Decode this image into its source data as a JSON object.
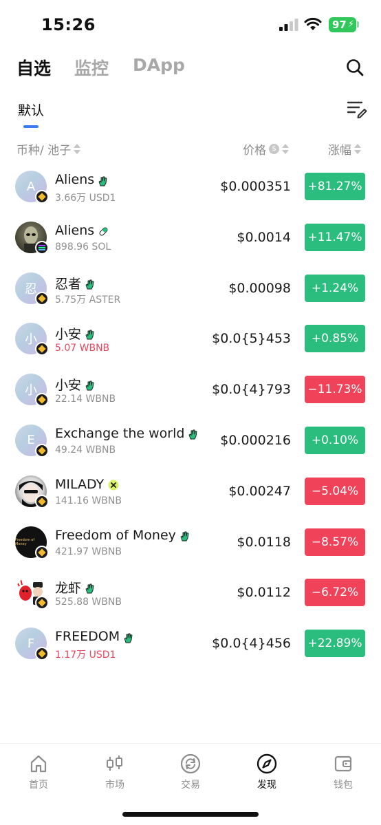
{
  "status_bar": {
    "time": "15:26",
    "battery": "97"
  },
  "top_tabs": [
    {
      "label": "自选",
      "active": true
    },
    {
      "label": "监控",
      "active": false
    },
    {
      "label": "DApp",
      "active": false
    }
  ],
  "sub_tabs": [
    {
      "label": "默认",
      "active": true
    }
  ],
  "columns": {
    "name": "币种/ 池子",
    "price": "价格",
    "change": "涨幅"
  },
  "rows": [
    {
      "name": "Aliens",
      "avatar": "A",
      "sub": "3.66万 USD1",
      "sub_red": false,
      "price": "$0.000351",
      "change": "+81.27%",
      "direction": "up",
      "chain": "bnb",
      "tag": "hand"
    },
    {
      "name": "Aliens",
      "avatar": "",
      "sub": "898.96 SOL",
      "sub_red": false,
      "price": "$0.0014",
      "change": "+11.47%",
      "direction": "up",
      "chain": "sol",
      "tag": "pill"
    },
    {
      "name": "忍者",
      "avatar": "忍",
      "sub": "5.75万 ASTER",
      "sub_red": false,
      "price": "$0.00098",
      "change": "+1.24%",
      "direction": "up",
      "chain": "bnb",
      "tag": "hand"
    },
    {
      "name": "小安",
      "avatar": "小",
      "sub": "5.07 WBNB",
      "sub_red": true,
      "price": "$0.0{5}453",
      "change": "+0.85%",
      "direction": "up",
      "chain": "bnb",
      "tag": "hand"
    },
    {
      "name": "小安",
      "avatar": "小",
      "sub": "22.14 WBNB",
      "sub_red": false,
      "price": "$0.0{4}793",
      "change": "−11.73%",
      "direction": "down",
      "chain": "bnb",
      "tag": "hand"
    },
    {
      "name": "Exchange the world",
      "avatar": "E",
      "sub": "49.24 WBNB",
      "sub_red": false,
      "price": "$0.000216",
      "change": "+0.10%",
      "direction": "up",
      "chain": "bnb",
      "tag": "hand"
    },
    {
      "name": "MILADY",
      "avatar": "",
      "sub": "141.16 WBNB",
      "sub_red": false,
      "price": "$0.00247",
      "change": "−5.04%",
      "direction": "down",
      "chain": "bnb",
      "tag": "x"
    },
    {
      "name": "Freedom of Money",
      "avatar": "Freedom of Money",
      "sub": "421.97 WBNB",
      "sub_red": false,
      "price": "$0.0118",
      "change": "−8.57%",
      "direction": "down",
      "chain": "bnb",
      "tag": "hand"
    },
    {
      "name": "龙虾",
      "avatar": "",
      "sub": "525.88 WBNB",
      "sub_red": false,
      "price": "$0.0112",
      "change": "−6.72%",
      "direction": "down",
      "chain": "bnb",
      "tag": "hand"
    },
    {
      "name": "FREEDOM",
      "avatar": "F",
      "sub": "1.17万 USD1",
      "sub_red": true,
      "price": "$0.0{4}456",
      "change": "+22.89%",
      "direction": "up",
      "chain": "bnb",
      "tag": "hand"
    }
  ],
  "bottom_nav": [
    {
      "label": "首页",
      "icon": "home-icon",
      "active": false
    },
    {
      "label": "市场",
      "icon": "candlestick-icon",
      "active": false
    },
    {
      "label": "交易",
      "icon": "swap-icon",
      "active": false
    },
    {
      "label": "发现",
      "icon": "compass-icon",
      "active": true
    },
    {
      "label": "钱包",
      "icon": "wallet-icon",
      "active": false
    }
  ],
  "colors": {
    "up": "#2bbd7e",
    "down": "#f0435a",
    "accent": "#3a7bf5",
    "sub_red": "#e9455d"
  }
}
